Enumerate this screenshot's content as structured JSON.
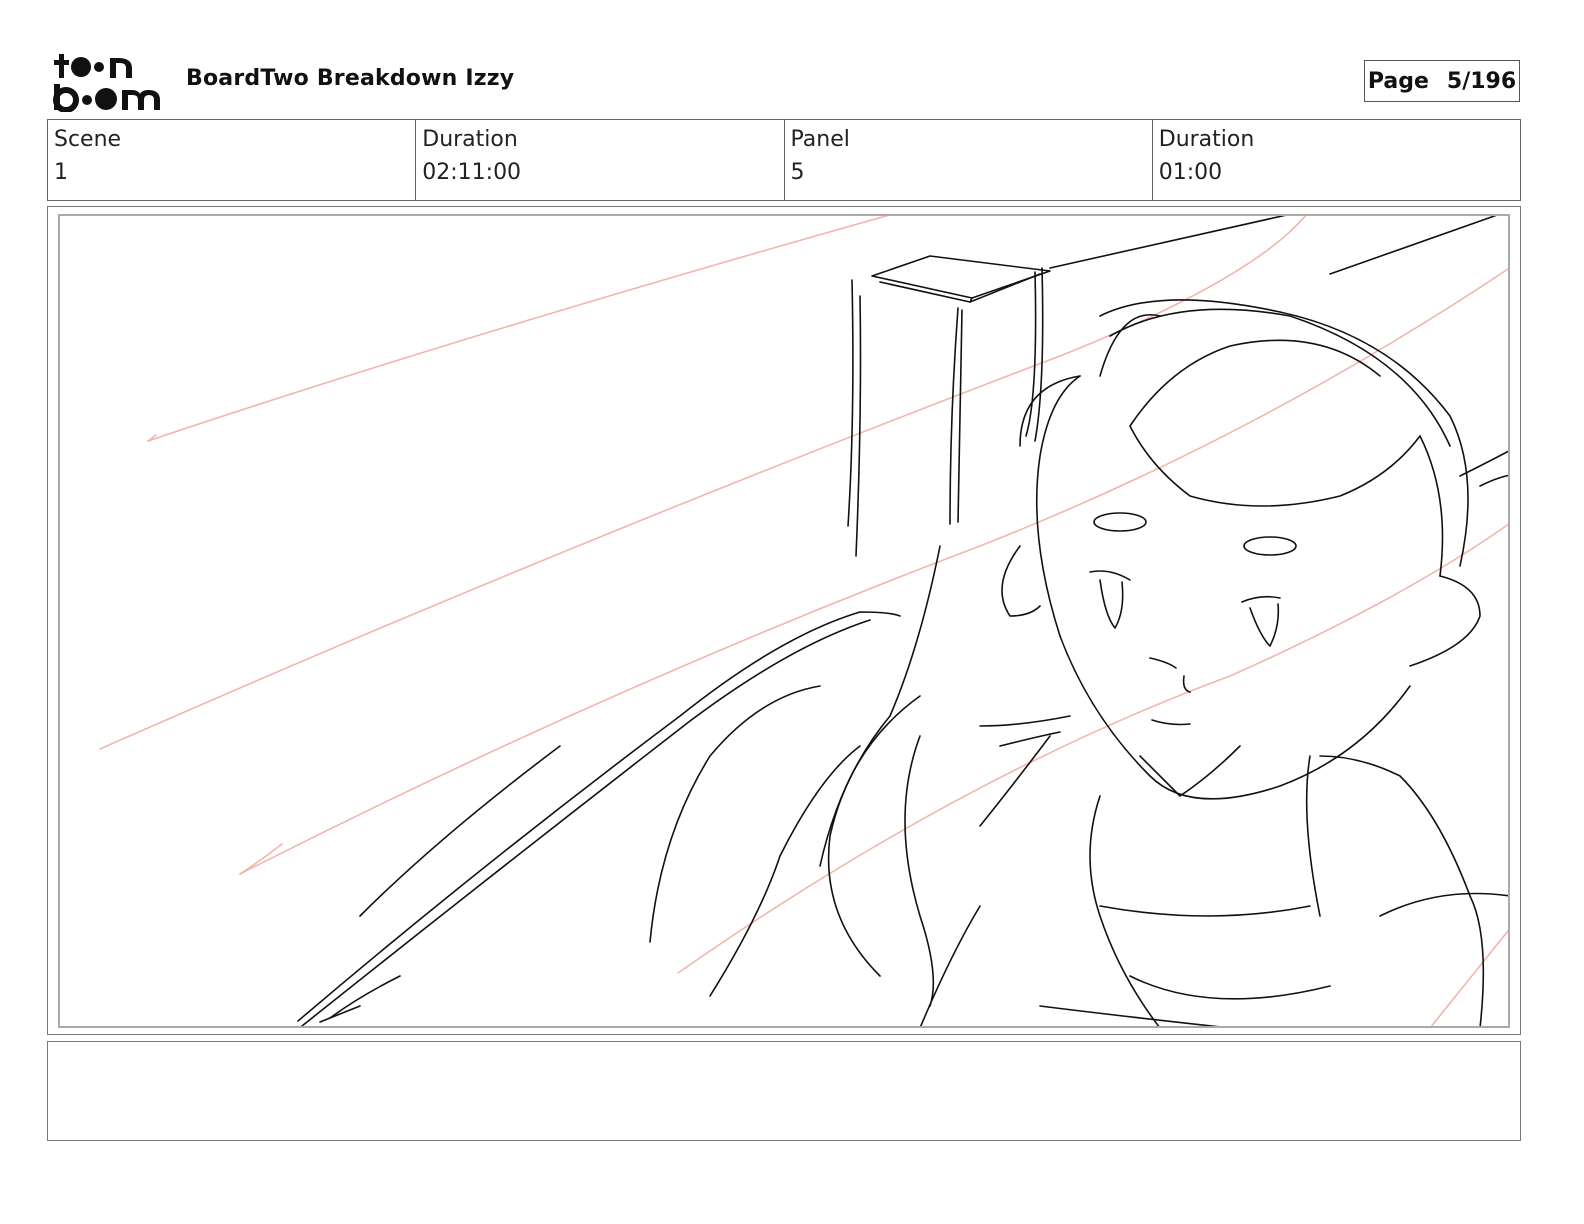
{
  "header": {
    "logo_text": "toon boom",
    "title": "BoardTwo Breakdown Izzy",
    "page_label": "Page",
    "page_value": "5/196"
  },
  "info": {
    "scene_label": "Scene",
    "scene_value": "1",
    "scene_duration_label": "Duration",
    "scene_duration_value": "02:11:00",
    "panel_label": "Panel",
    "panel_value": "5",
    "panel_duration_label": "Duration",
    "panel_duration_value": "01:00"
  },
  "panel": {
    "image_description_alt": "",
    "sketch_color": "#111111",
    "guide_line_color": "#f0b6ad"
  },
  "notes": {
    "text": ""
  }
}
